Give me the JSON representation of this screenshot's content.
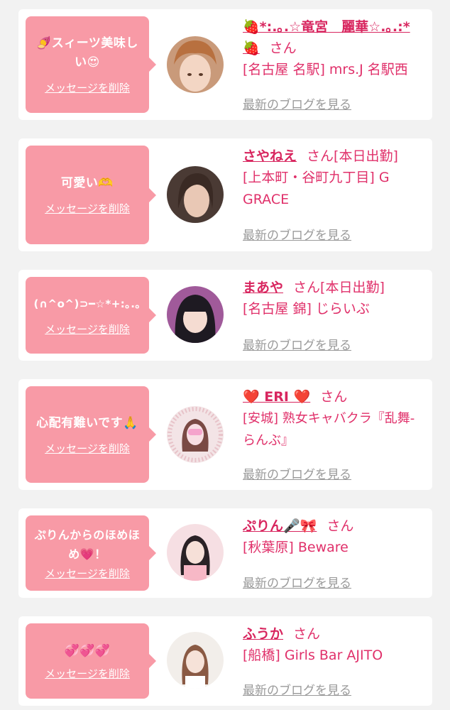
{
  "colors": {
    "bubble": "#f89aa6",
    "accent": "#e0306a",
    "muted": "#9a9a9a",
    "card": "#ffffff",
    "background": "#f2f2f2"
  },
  "delete_label": "メッセージを削除",
  "blog_label": "最新のブログを見る",
  "san_label": "さん",
  "cards": [
    {
      "message": "🍠スィーツ美味しい😍",
      "name": "🍓*:.｡.☆竜宮　麗華☆.｡.:*🍓",
      "attendance": "",
      "shop": "[名古屋 名駅] mrs.J 名駅西",
      "avatar_icon": "woman-avatar"
    },
    {
      "message": "可愛い🫶",
      "name": "さやねえ",
      "attendance": "[本日出勤]",
      "shop": "[上本町・谷町九丁目] G GRACE",
      "avatar_icon": "woman-avatar"
    },
    {
      "message": "(∩^o^)⊃━☆*+:｡.｡",
      "name": "まあや",
      "attendance": "[本日出勤]",
      "shop": "[名古屋 錦] じらいぶ",
      "avatar_icon": "woman-avatar"
    },
    {
      "message": "心配有難いです🙏",
      "name": "❤️ ERI ❤️",
      "attendance": "",
      "shop": "[安城] 熟女キャバクラ『乱舞-らんぶ』",
      "avatar_icon": "woman-avatar"
    },
    {
      "message": "ぷりんからのほめほめ💗！",
      "name": "ぷりん🎤🎀",
      "attendance": "",
      "shop": "[秋葉原] Beware",
      "avatar_icon": "woman-avatar"
    },
    {
      "message": "💞💞💞",
      "name": "ふうか",
      "attendance": "",
      "shop": "[船橋] Girls Bar AJITO",
      "avatar_icon": "woman-avatar"
    }
  ]
}
